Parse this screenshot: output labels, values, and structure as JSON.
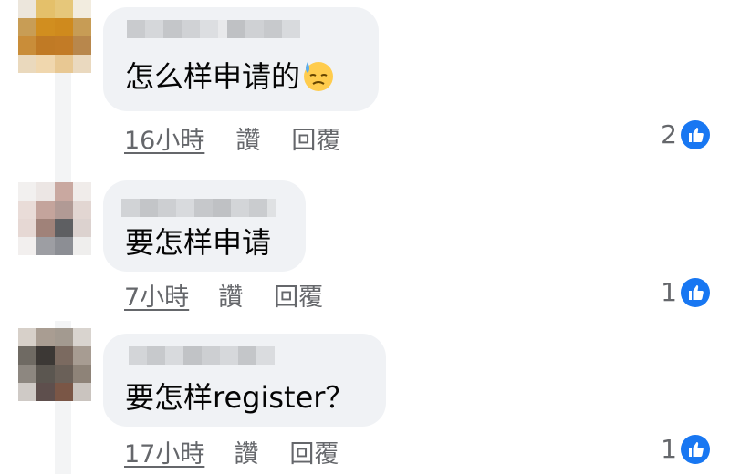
{
  "colors": {
    "bubble_bg": "#f0f2f5",
    "meta_text": "#65676b",
    "comment_text": "#050505",
    "like_blue": "#1877f2"
  },
  "comments": [
    {
      "text": "怎么样申请的",
      "emoji": "downcast-face-with-sweat",
      "time": "16小時",
      "like_label": "讚",
      "reply_label": "回覆",
      "reaction_count": "2",
      "reaction_icon": "like-icon"
    },
    {
      "text": "要怎样申请",
      "time": "7小時",
      "like_label": "讚",
      "reply_label": "回覆",
      "reaction_count": "1",
      "reaction_icon": "like-icon"
    },
    {
      "text": "要怎样register？",
      "time": "17小時",
      "like_label": "讚",
      "reply_label": "回覆",
      "reaction_count": "1",
      "reaction_icon": "like-icon"
    }
  ]
}
